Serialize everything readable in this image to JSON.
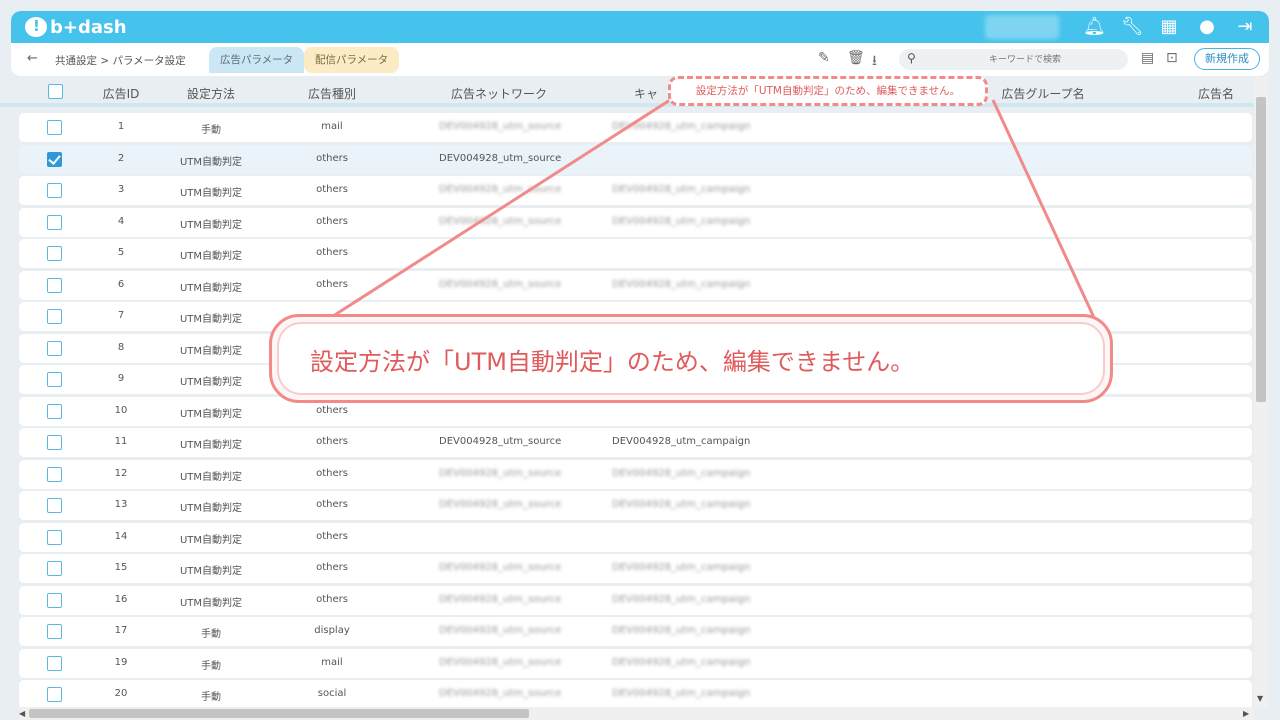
{
  "header": {
    "logo_text": "b+dash",
    "icons": [
      "bell-icon",
      "wrench-icon",
      "grid-icon",
      "robot-icon",
      "logout-icon"
    ],
    "accent_color": "#46c3ec"
  },
  "subbar": {
    "back_icon": "←",
    "breadcrumb": "共通設定 > パラメータ設定",
    "tabs": [
      "広告パラメータ",
      "配信パラメータ"
    ],
    "search_placeholder": "キーワードで検索",
    "new_button": "新規作成"
  },
  "table": {
    "headers": [
      "広告ID",
      "設定方法",
      "広告種別",
      "広告ネットワーク",
      "キャ",
      "広告グループ名",
      "広告名"
    ],
    "rows": [
      {
        "id": "1",
        "method": "手動",
        "type": "mail",
        "network": "DEV004928_utm_source",
        "campaign": "DEV004928_utm_campaign",
        "checked": false
      },
      {
        "id": "2",
        "method": "UTM自動判定",
        "type": "others",
        "network": "DEV004928_utm_source",
        "campaign": "",
        "checked": true
      },
      {
        "id": "3",
        "method": "UTM自動判定",
        "type": "others",
        "network": "DEV004928_utm_source",
        "campaign": "DEV004928_utm_campaign",
        "checked": false
      },
      {
        "id": "4",
        "method": "UTM自動判定",
        "type": "others",
        "network": "DEV004928_utm_source",
        "campaign": "DEV004928_utm_campaign",
        "checked": false
      },
      {
        "id": "5",
        "method": "UTM自動判定",
        "type": "others",
        "network": "",
        "campaign": "",
        "checked": false
      },
      {
        "id": "6",
        "method": "UTM自動判定",
        "type": "others",
        "network": "DEV004928_utm_source",
        "campaign": "DEV004928_utm_campaign",
        "checked": false
      },
      {
        "id": "7",
        "method": "UTM自動判定",
        "type": "",
        "network": "",
        "campaign": "",
        "checked": false
      },
      {
        "id": "8",
        "method": "UTM自動判定",
        "type": "",
        "network": "",
        "campaign": "",
        "checked": false
      },
      {
        "id": "9",
        "method": "UTM自動判定",
        "type": "",
        "network": "",
        "campaign": "",
        "checked": false
      },
      {
        "id": "10",
        "method": "UTM自動判定",
        "type": "others",
        "network": "",
        "campaign": "",
        "checked": false
      },
      {
        "id": "11",
        "method": "UTM自動判定",
        "type": "others",
        "network": "DEV004928_utm_source",
        "campaign": "DEV004928_utm_campaign",
        "checked": false
      },
      {
        "id": "12",
        "method": "UTM自動判定",
        "type": "others",
        "network": "DEV004928_utm_source",
        "campaign": "DEV004928_utm_campaign",
        "checked": false
      },
      {
        "id": "13",
        "method": "UTM自動判定",
        "type": "others",
        "network": "DEV004928_utm_source",
        "campaign": "DEV004928_utm_campaign",
        "checked": false
      },
      {
        "id": "14",
        "method": "UTM自動判定",
        "type": "others",
        "network": "",
        "campaign": "",
        "checked": false
      },
      {
        "id": "15",
        "method": "UTM自動判定",
        "type": "others",
        "network": "DEV004928_utm_source",
        "campaign": "DEV004928_utm_campaign",
        "checked": false
      },
      {
        "id": "16",
        "method": "UTM自動判定",
        "type": "others",
        "network": "DEV004928_utm_source",
        "campaign": "DEV004928_utm_campaign",
        "checked": false
      },
      {
        "id": "17",
        "method": "手動",
        "type": "display",
        "network": "DEV004928_utm_source",
        "campaign": "DEV004928_utm_campaign",
        "checked": false
      },
      {
        "id": "19",
        "method": "手動",
        "type": "mail",
        "network": "DEV004928_utm_source",
        "campaign": "DEV004928_utm_campaign",
        "checked": false
      },
      {
        "id": "20",
        "method": "手動",
        "type": "social",
        "network": "DEV004928_utm_source",
        "campaign": "DEV004928_utm_campaign",
        "checked": false
      }
    ],
    "clear_rows": [
      "2",
      "11"
    ]
  },
  "tooltip": {
    "small_text": "設定方法が「UTM自動判定」のため、編集できません。",
    "big_text": "設定方法が「UTM自動判定」のため、編集できません。",
    "color": "#f28a8a"
  }
}
